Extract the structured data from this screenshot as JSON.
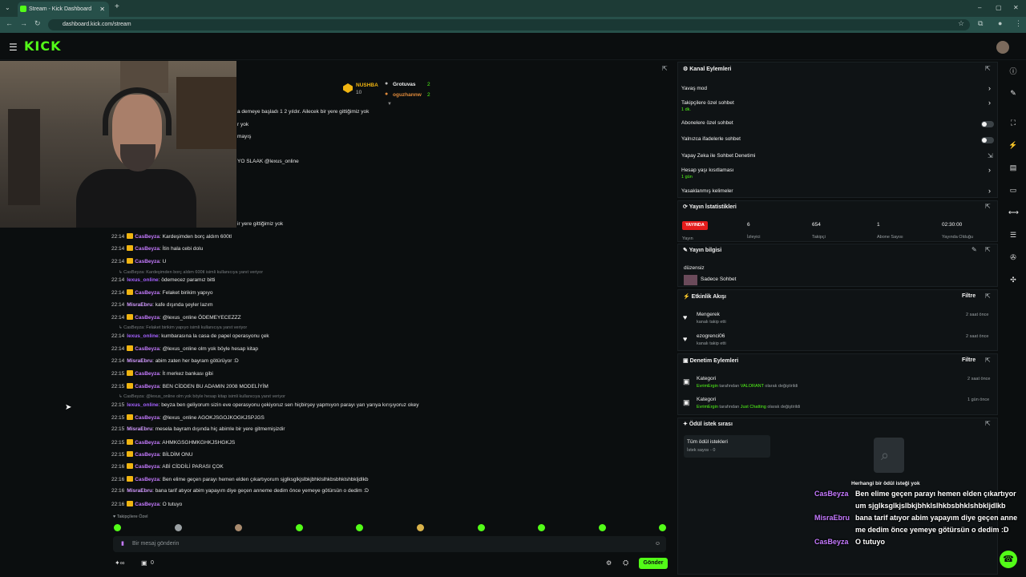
{
  "browser": {
    "tab_title": "Stream - Kick Dashboard",
    "url": "dashboard.kick.com/stream",
    "new_tab": "+"
  },
  "app": {
    "logo": "KICK"
  },
  "leaderboard": {
    "first": {
      "name": "NUSHBA",
      "score": "10"
    },
    "rows": [
      {
        "name": "Grotuvas",
        "score": "2"
      },
      {
        "name": "oguzhannw",
        "score": "2"
      }
    ]
  },
  "chat": {
    "top_fragments": [
      "a demeye başladı 1 2 yıldır. Ailecek bir yere gittiğimiz yok",
      "r yok",
      "mayış",
      "YO SLAAK @lexus_online",
      "ir yere gittiğimiz yok"
    ],
    "messages": [
      {
        "time": "22:14",
        "user": "CasBeyza",
        "text": ": Kardeşimden borç aldım 600tl"
      },
      {
        "time": "22:14",
        "user": "CasBeyza",
        "text": ": İtin hala cebi dolu"
      },
      {
        "time": "22:14",
        "user": "CasBeyza",
        "text": ": U"
      },
      {
        "reply": "CasBeyza: Kardeşimden borç aldım 600tl isimli kullanıcıya yanıt veriyor"
      },
      {
        "time": "22:14",
        "user": "lexus_online",
        "text": ": ödemecez paramız bitti"
      },
      {
        "time": "22:14",
        "user": "CasBeyza",
        "text": ": Felaket birikim yapıyo"
      },
      {
        "time": "22:14",
        "user": "MisraEbru",
        "text": ": kafe dışında şeyler lazım"
      },
      {
        "time": "22:14",
        "user": "CasBeyza",
        "text": ": @lexus_online ÖDEMEYECEZZZ"
      },
      {
        "reply": "CasBeyza: Felaket birikim yapıyo isimli kullanıcıya yanıt veriyor"
      },
      {
        "time": "22:14",
        "user": "lexus_online",
        "text": ": kumbarasına la casa de papel operasyonu çek"
      },
      {
        "time": "22:14",
        "user": "CasBeyza",
        "text": ": @lexus_online olm yok böyle hesap kitap"
      },
      {
        "time": "22:14",
        "user": "MisraEbru",
        "text": ": abim zaten her bayram götürüyor :D"
      },
      {
        "time": "22:15",
        "user": "CasBeyza",
        "text": ": İt merkez bankası gibi"
      },
      {
        "time": "22:15",
        "user": "CasBeyza",
        "text": ": BEN CİDDEN BU ADAMIN 2008 MODELİYİM"
      },
      {
        "reply": "CasBeyza: @lexus_online olm yok böyle hesap kitap isimli kullanıcıya yanıt veriyor"
      },
      {
        "time": "22:15",
        "user": "lexus_online",
        "text": ": beyza ben geliyorum sizin eve operasyonu çekiyoruz sen hiçbirşey yapmıyon parayı yarı yarıya kırışıyoruz okey"
      },
      {
        "time": "22:15",
        "user": "CasBeyza",
        "text": ": @lexus_online AGOKJSGOJKOGKJSPJGS"
      },
      {
        "time": "22:15",
        "user": "MisraEbru",
        "text": ": mesela bayram dışında hiç abimle bir yere gitmemişizdir"
      },
      {
        "time": "22:15",
        "user": "CasBeyza",
        "text": ": AHMKGSGHMKGHKJSHGKJS"
      },
      {
        "time": "22:15",
        "user": "CasBeyza",
        "text": ": BİLDİM ONU"
      },
      {
        "time": "22:16",
        "user": "CasBeyza",
        "text": ": ABİ CİDDİLİ PARASI ÇOK"
      },
      {
        "time": "22:16",
        "user": "CasBeyza",
        "text": ": Ben elime geçen parayı hemen elden çıkartıyorum sjglksglkjslbkjbhklslhkbsbhklshbkljdlkb"
      },
      {
        "time": "22:16",
        "user": "MisraEbru",
        "text": ": bana tarif atıyor abim yapayım diye geçen anneme dedim önce yemeye götürsün o dedim :D"
      },
      {
        "time": "22:16",
        "user": "CasBeyza",
        "text": ": O tutuyo"
      }
    ],
    "followers_only": "Takipçilere Özel",
    "input_placeholder": "Bir mesaj gönderin",
    "send_label": "Gönder",
    "counter": "0"
  },
  "channel_actions": {
    "title": "Kanal Eylemleri",
    "items": [
      {
        "label": "Yavaş mod",
        "sub": ""
      },
      {
        "label": "Takipçilere özel sohbet",
        "sub": "1 dk."
      },
      {
        "label": "Abonelere özel sohbet",
        "sub": ""
      },
      {
        "label": "Yalnızca ifadelerle sohbet",
        "sub": ""
      },
      {
        "label": "Yapay Zeka ile Sohbet Denetimi",
        "sub": ""
      },
      {
        "label": "Hesap yaşı kısıtlaması",
        "sub": "1 gün"
      },
      {
        "label": "Yasaklanmış kelimeler",
        "sub": ""
      }
    ]
  },
  "stream_stats": {
    "title": "Yayın İstatistikleri",
    "live": "YAYINDA",
    "live_sub": "Yayın",
    "stats": [
      {
        "value": "6",
        "label": "İzleyici"
      },
      {
        "value": "654",
        "label": "Takipçi"
      },
      {
        "value": "1",
        "label": "Abone Sayısı"
      },
      {
        "value": "02:30:00",
        "label": "Yayında Olduğu"
      }
    ]
  },
  "stream_info": {
    "title": "Yayın bilgisi",
    "stream_title": "düzensiz",
    "category": "Sadece Sohbet"
  },
  "activity": {
    "title": "Etkinlik Akışı",
    "filter": "Filtre",
    "items": [
      {
        "name": "Mengerek",
        "action": "kanalı takip etti",
        "time": "2 saat önce"
      },
      {
        "name": "ezogrenci06",
        "action": "kanalı takip etti",
        "time": "2 saat önce"
      }
    ]
  },
  "moderation": {
    "title": "Denetim Eylemleri",
    "filter": "Filtre",
    "items": [
      {
        "label": "Kategori",
        "who": "EvrimErgin",
        "mid": " tarafından ",
        "val": "VALORANT",
        "end": " olarak değiştirildi",
        "time": "2 saat önce"
      },
      {
        "label": "Kategori",
        "who": "EvrimErgin",
        "mid": " tarafından ",
        "val": "Just Chatting",
        "end": " olarak değiştirildi",
        "time": "1 gün önce"
      }
    ]
  },
  "rewards": {
    "title": "Ödül istek sırası",
    "tab": "Tüm ödül istekleri",
    "tab_sub": "İstek sayısı - 0",
    "empty": "Herhangi bir ödül isteği yok"
  },
  "overlay": [
    {
      "user": "CasBeyza",
      "text": "Ben elime geçen parayı hemen elden çıkartıyorum sjglksglkjslbkjbhklslhkbsbhklshbkljdlkb"
    },
    {
      "user": "MisraEbru",
      "text": "bana tarif atıyor abim yapayım diye geçen anneme dedim önce yemeye götürsün o dedim :D"
    },
    {
      "user": "CasBeyza",
      "text": "O tutuyo"
    }
  ],
  "colors": {
    "brand": "#53fc18",
    "live": "#e41c1c",
    "badge": "#f1b511"
  }
}
